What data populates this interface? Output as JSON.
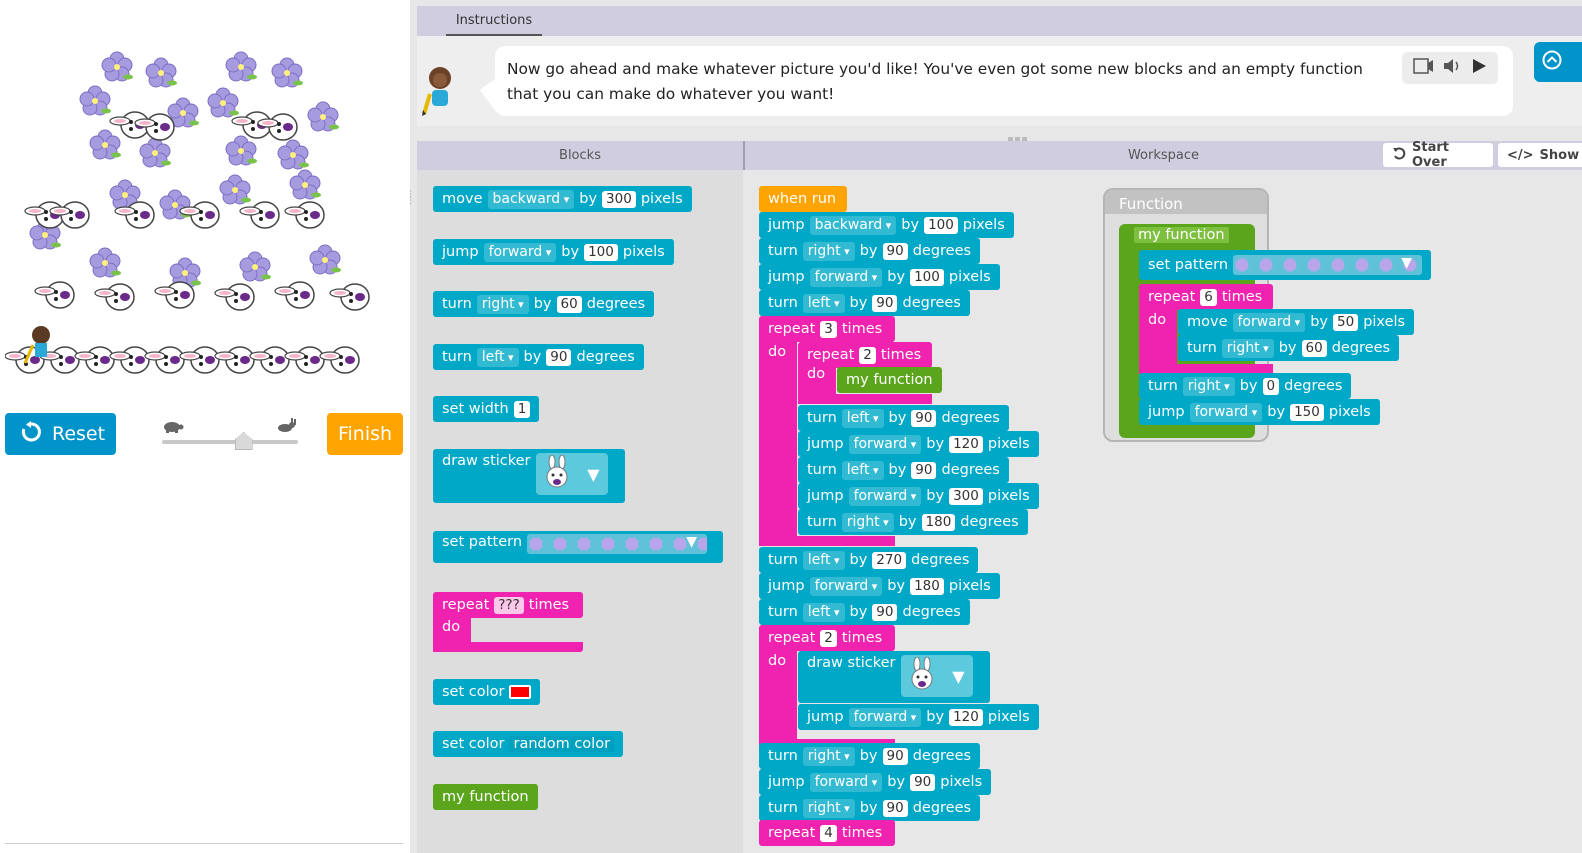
{
  "instructions": {
    "tab_label": "Instructions",
    "text": "Now go ahead and make whatever picture you'd like! You've even got some new blocks and an empty function that you can make do whatever you want!"
  },
  "controls": {
    "reset_label": "Reset",
    "finish_label": "Finish",
    "speed_level": 0.6
  },
  "headers": {
    "blocks": "Blocks",
    "workspace": "Workspace",
    "start_over": "Start Over",
    "show_code": "Show"
  },
  "toolbox": {
    "move": {
      "verb": "move",
      "dir": "backward",
      "by": "by",
      "value": "300",
      "unit": "pixels"
    },
    "jump": {
      "verb": "jump",
      "dir": "forward",
      "by": "by",
      "value": "100",
      "unit": "pixels"
    },
    "turn_right": {
      "verb": "turn",
      "dir": "right",
      "by": "by",
      "value": "60",
      "unit": "degrees"
    },
    "turn_left": {
      "verb": "turn",
      "dir": "left",
      "by": "by",
      "value": "90",
      "unit": "degrees"
    },
    "set_width": {
      "label": "set width",
      "value": "1"
    },
    "draw_sticker": {
      "label": "draw sticker"
    },
    "set_pattern": {
      "label": "set pattern"
    },
    "repeat": {
      "label": "repeat",
      "value": "???",
      "times": "times",
      "do": "do"
    },
    "set_color": {
      "label": "set color",
      "color": "#ff0000"
    },
    "set_color_random": {
      "label": "set color",
      "value": "random color"
    },
    "my_function": {
      "label": "my function"
    }
  },
  "workspace": {
    "when_run": "when run",
    "main": [
      {
        "verb": "jump",
        "dir": "backward",
        "value": "100",
        "unit": "pixels"
      },
      {
        "verb": "turn",
        "dir": "right",
        "value": "90",
        "unit": "degrees"
      },
      {
        "verb": "jump",
        "dir": "forward",
        "value": "100",
        "unit": "pixels"
      },
      {
        "verb": "turn",
        "dir": "left",
        "value": "90",
        "unit": "degrees"
      }
    ],
    "repeat1": {
      "value": "3"
    },
    "repeat1_inner": {
      "value": "2",
      "call": "my function"
    },
    "repeat1_body": [
      {
        "verb": "turn",
        "dir": "left",
        "value": "90",
        "unit": "degrees"
      },
      {
        "verb": "jump",
        "dir": "forward",
        "value": "120",
        "unit": "pixels"
      },
      {
        "verb": "turn",
        "dir": "left",
        "value": "90",
        "unit": "degrees"
      },
      {
        "verb": "jump",
        "dir": "forward",
        "value": "300",
        "unit": "pixels"
      },
      {
        "verb": "turn",
        "dir": "right",
        "value": "180",
        "unit": "degrees"
      }
    ],
    "after1": [
      {
        "verb": "turn",
        "dir": "left",
        "value": "270",
        "unit": "degrees"
      },
      {
        "verb": "jump",
        "dir": "forward",
        "value": "180",
        "unit": "pixels"
      },
      {
        "verb": "turn",
        "dir": "left",
        "value": "90",
        "unit": "degrees"
      }
    ],
    "repeat2": {
      "value": "2",
      "sticker": "draw sticker"
    },
    "repeat2_jump": {
      "verb": "jump",
      "dir": "forward",
      "value": "120",
      "unit": "pixels"
    },
    "after2": [
      {
        "verb": "turn",
        "dir": "right",
        "value": "90",
        "unit": "degrees"
      },
      {
        "verb": "jump",
        "dir": "forward",
        "value": "90",
        "unit": "pixels"
      },
      {
        "verb": "turn",
        "dir": "right",
        "value": "90",
        "unit": "degrees"
      }
    ],
    "repeat3": {
      "value": "4"
    },
    "words": {
      "repeat": "repeat",
      "times": "times",
      "do": "do",
      "by": "by"
    }
  },
  "function_def": {
    "title": "Function",
    "name": "my function",
    "set_pattern": "set pattern",
    "repeat_value": "6",
    "inner": [
      {
        "verb": "move",
        "dir": "forward",
        "value": "50",
        "unit": "pixels"
      },
      {
        "verb": "turn",
        "dir": "right",
        "value": "60",
        "unit": "degrees"
      }
    ],
    "after": [
      {
        "verb": "turn",
        "dir": "right",
        "value": "0",
        "unit": "degrees"
      },
      {
        "verb": "jump",
        "dir": "forward",
        "value": "150",
        "unit": "pixels"
      }
    ]
  },
  "colors": {
    "motion": "#00a8c8",
    "loop": "#f022b0",
    "function": "#5ba51d",
    "event": "#ffa400",
    "accent": "#0094ca"
  }
}
